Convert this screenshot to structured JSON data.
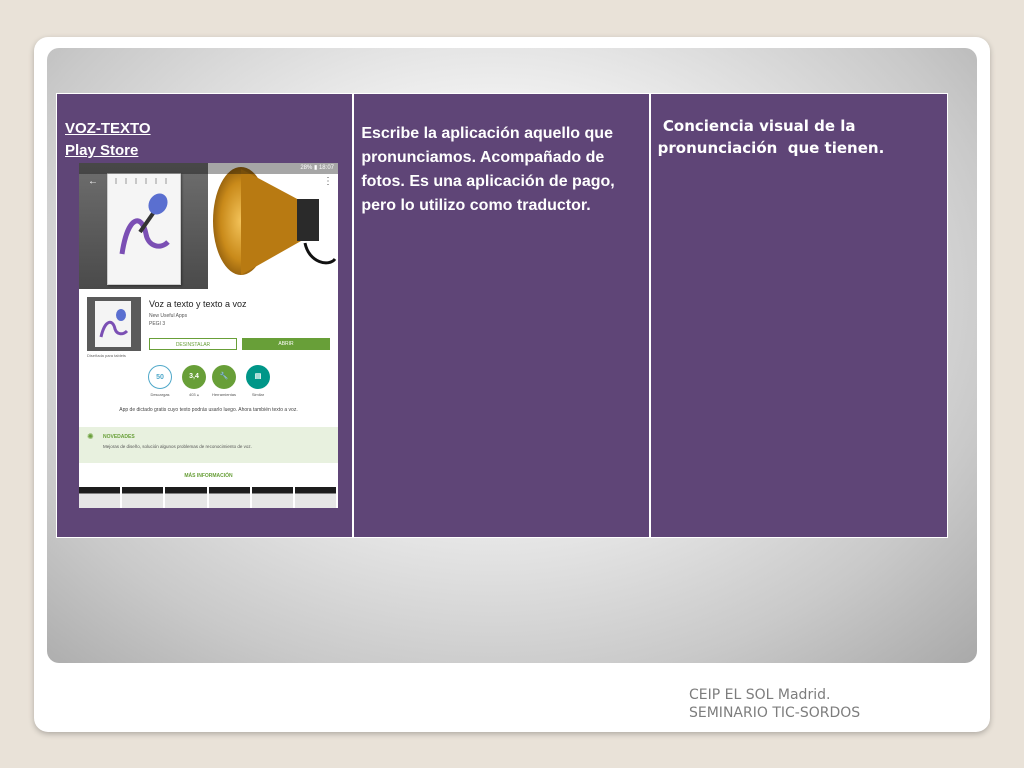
{
  "cells": {
    "col1": {
      "title_line1": "VOZ-TEXTO",
      "title_line2": "Play Store"
    },
    "col2": {
      "text": "Escribe la aplicación aquello que pronunciamos. Acompañado de fotos. Es una aplicación  de pago, pero lo utilizo como traductor."
    },
    "col3": {
      "text": " Conciencia visual de la pronunciación  que tienen."
    }
  },
  "screenshot": {
    "status": "28% ▮ 18:07",
    "app_name": "Voz a texto y texto a voz",
    "developer": "New Useful Apps",
    "pegi": "PEGI 3",
    "btn_uninstall": "DESINSTALAR",
    "btn_open": "ABRIR",
    "tablet_note": "Diseñada para tablets",
    "badges": [
      {
        "value": "50",
        "label": "Descargas",
        "color": "#ffffff"
      },
      {
        "value": "3,4",
        "label": "403 ⩓",
        "color": "#689f38"
      },
      {
        "value": "",
        "label": "Herramientas",
        "color": "#689f38"
      },
      {
        "value": "",
        "label": "Similar",
        "color": "#009688"
      }
    ],
    "description": "App de dictado gratis cuyo texto podrás usarlo luego. Ahora también texto a voz.",
    "news_title": "NOVEDADES",
    "news_text": "Mejoras de diseño, solución algunos problemas de reconocimiento de voz.",
    "more_info": "MÁS INFORMACIÓN"
  },
  "footer": {
    "line1": "CEIP EL SOL Madrid.",
    "line2": "SEMINARIO TIC-SORDOS"
  },
  "colors": {
    "cell_bg": "#5f4577",
    "accent_green": "#689f38"
  }
}
